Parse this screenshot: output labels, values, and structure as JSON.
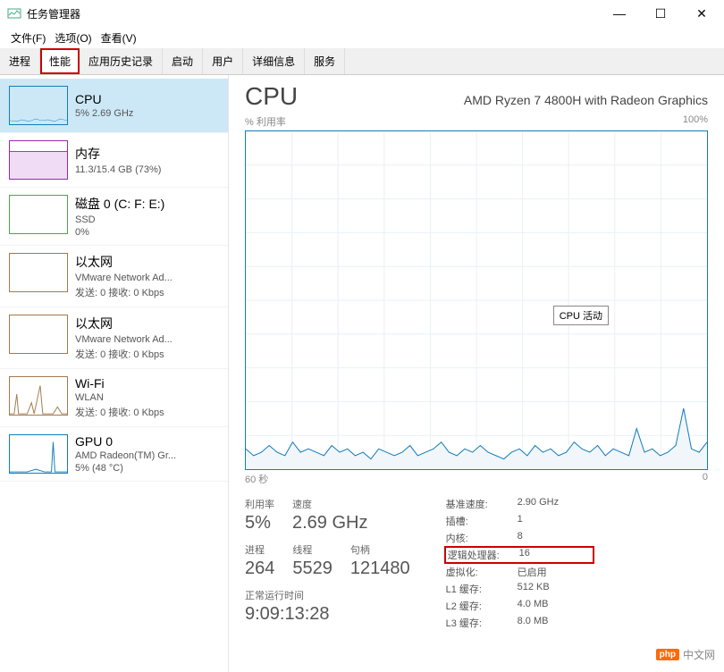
{
  "window": {
    "title": "任务管理器",
    "minimize": "—",
    "maximize": "☐",
    "close": "✕"
  },
  "menu": {
    "file": "文件(F)",
    "options": "选项(O)",
    "view": "查看(V)"
  },
  "tabs": {
    "processes": "进程",
    "performance": "性能",
    "history": "应用历史记录",
    "startup": "启动",
    "users": "用户",
    "details": "详细信息",
    "services": "服务"
  },
  "sidebar": {
    "cpu": {
      "title": "CPU",
      "sub": "5% 2.69 GHz",
      "color": "#117dbb"
    },
    "memory": {
      "title": "内存",
      "sub": "11.3/15.4 GB (73%)",
      "color": "#9528b4"
    },
    "disk": {
      "title": "磁盘 0 (C: F: E:)",
      "sub1": "SSD",
      "sub2": "0%",
      "color": "#4ca64c"
    },
    "eth1": {
      "title": "以太网",
      "sub1": "VMware Network Ad...",
      "sub2": "发送: 0 接收: 0 Kbps",
      "color": "#a17a4c"
    },
    "eth2": {
      "title": "以太网",
      "sub1": "VMware Network Ad...",
      "sub2": "发送: 0 接收: 0 Kbps",
      "color": "#a17a4c"
    },
    "wifi": {
      "title": "Wi-Fi",
      "sub1": "WLAN",
      "sub2": "发送: 0 接收: 0 Kbps",
      "color": "#a17a4c"
    },
    "gpu": {
      "title": "GPU 0",
      "sub1": "AMD Radeon(TM) Gr...",
      "sub2": "5% (48 °C)",
      "color": "#117dbb"
    }
  },
  "detail": {
    "title": "CPU",
    "model": "AMD Ryzen 7 4800H with Radeon Graphics",
    "ylabel": "% 利用率",
    "ymax": "100%",
    "xlabel_left": "60 秒",
    "xlabel_right": "0",
    "tooltip": "CPU 活动"
  },
  "stats": {
    "util_label": "利用率",
    "util": "5%",
    "speed_label": "速度",
    "speed": "2.69 GHz",
    "proc_label": "进程",
    "proc": "264",
    "thread_label": "线程",
    "thread": "5529",
    "handle_label": "句柄",
    "handle": "121480",
    "uptime_label": "正常运行时间",
    "uptime": "9:09:13:28"
  },
  "specs": {
    "base_label": "基准速度:",
    "base": "2.90 GHz",
    "socket_label": "插槽:",
    "socket": "1",
    "core_label": "内核:",
    "core": "8",
    "logical_label": "逻辑处理器:",
    "logical": "16",
    "virt_label": "虚拟化:",
    "virt": "已启用",
    "l1_label": "L1 缓存:",
    "l1": "512 KB",
    "l2_label": "L2 缓存:",
    "l2": "4.0 MB",
    "l3_label": "L3 缓存:",
    "l3": "8.0 MB"
  },
  "chart_data": {
    "type": "line",
    "title": "CPU 活动",
    "xlabel": "秒",
    "ylabel": "% 利用率",
    "ylim": [
      0,
      100
    ],
    "xlim": [
      60,
      0
    ],
    "series": [
      {
        "name": "CPU 利用率",
        "values": [
          6,
          4,
          5,
          7,
          5,
          4,
          8,
          5,
          6,
          5,
          4,
          7,
          5,
          6,
          4,
          5,
          3,
          6,
          5,
          4,
          5,
          7,
          4,
          5,
          6,
          8,
          5,
          4,
          6,
          5,
          7,
          5,
          4,
          3,
          5,
          6,
          4,
          7,
          5,
          6,
          4,
          5,
          8,
          6,
          5,
          7,
          4,
          6,
          5,
          4,
          12,
          5,
          6,
          4,
          5,
          7,
          18,
          6,
          5,
          8
        ]
      }
    ]
  },
  "watermark": {
    "badge": "php",
    "text": "中文网"
  }
}
